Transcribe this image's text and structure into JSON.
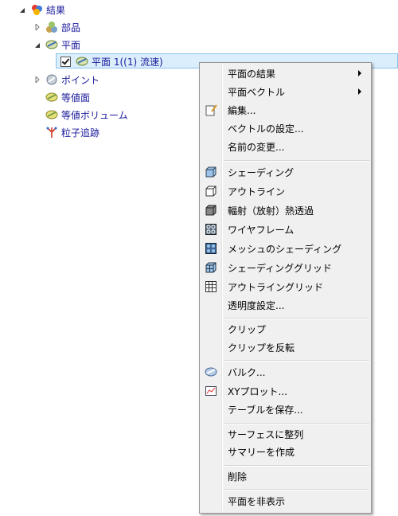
{
  "tree": {
    "root_label": "結果",
    "parts_label": "部品",
    "plane_label": "平面",
    "selected_label": "平面 1((1) 流速)",
    "point_label": "ポイント",
    "isosurface_label": "等値面",
    "isovolume_label": "等値ボリューム",
    "particle_label": "粒子追跡"
  },
  "menu": {
    "items": [
      {
        "label": "平面の結果",
        "submenu": true
      },
      {
        "label": "平面ベクトル",
        "submenu": true
      },
      {
        "label": "編集...",
        "icon": "edit-icon"
      },
      {
        "label": "ベクトルの設定..."
      },
      {
        "label": "名前の変更..."
      },
      {
        "label": "シェーディング",
        "icon": "shading-icon"
      },
      {
        "label": "アウトライン",
        "icon": "outline-icon"
      },
      {
        "label": "輻射（放射）熱透過",
        "icon": "radiation-icon"
      },
      {
        "label": "ワイヤフレーム",
        "icon": "wireframe-icon"
      },
      {
        "label": "メッシュのシェーディング",
        "icon": "mesh-shading-icon"
      },
      {
        "label": "シェーディンググリッド",
        "icon": "shading-grid-icon"
      },
      {
        "label": "アウトライングリッド",
        "icon": "outline-grid-icon"
      },
      {
        "label": "透明度設定..."
      },
      {
        "label": "クリップ"
      },
      {
        "label": "クリップを反転"
      },
      {
        "label": "バルク...",
        "icon": "bulk-icon"
      },
      {
        "label": "XYプロット...",
        "icon": "xy-plot-icon"
      },
      {
        "label": "テーブルを保存..."
      },
      {
        "label": "サーフェスに整列"
      },
      {
        "label": "サマリーを作成"
      },
      {
        "label": "削除"
      },
      {
        "label": "平面を非表示"
      }
    ]
  }
}
